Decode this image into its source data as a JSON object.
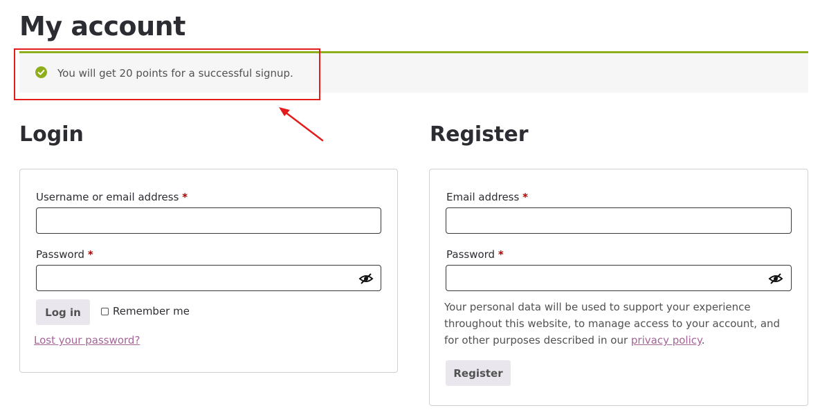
{
  "page": {
    "title": "My account"
  },
  "notice": {
    "icon": "check-circle-icon",
    "message": "You will get 20 points for a successful signup.",
    "accent_color": "#8fae1b",
    "highlight_color": "#e41b1b"
  },
  "login": {
    "heading": "Login",
    "username_label": "Username or email address",
    "password_label": "Password",
    "required_marker": "*",
    "submit_label": "Log in",
    "remember_label": "Remember me",
    "lost_password_link": "Lost your password?"
  },
  "register": {
    "heading": "Register",
    "email_label": "Email address",
    "password_label": "Password",
    "required_marker": "*",
    "privacy_text_before": "Your personal data will be used to support your experience throughout this website, to manage access to your account, and for other purposes described in our ",
    "privacy_link": "privacy policy",
    "privacy_text_after": ".",
    "submit_label": "Register"
  }
}
